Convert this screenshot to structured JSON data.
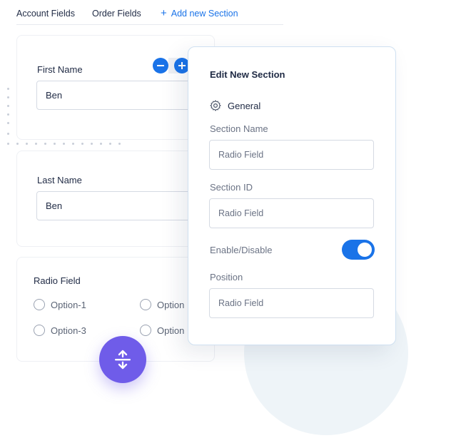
{
  "tabs": {
    "account": "Account Fields",
    "order": "Order Fields",
    "add_section": "Add new Section"
  },
  "cards": {
    "first_name": {
      "label": "First Name",
      "value": "Ben"
    },
    "last_name": {
      "label": "Last Name",
      "value": "Ben"
    },
    "radio": {
      "label": "Radio Field",
      "options": [
        "Option-1",
        "Option",
        "Option-3",
        "Option"
      ]
    }
  },
  "panel": {
    "title": "Edit New Section",
    "general": "General",
    "section_name": {
      "label": "Section Name",
      "placeholder": "Radio Field"
    },
    "section_id": {
      "label": "Section ID",
      "placeholder": "Radio Field"
    },
    "enable_disable": {
      "label": "Enable/Disable",
      "enabled": true
    },
    "position": {
      "label": "Position",
      "placeholder": "Radio Field"
    }
  },
  "colors": {
    "accent": "#1a73e8",
    "fab": "#6f5ce9"
  },
  "icons": {
    "add": "plus-icon",
    "remove": "minus-icon",
    "general": "gear-icon",
    "fab": "split-vertical-arrows-icon"
  }
}
